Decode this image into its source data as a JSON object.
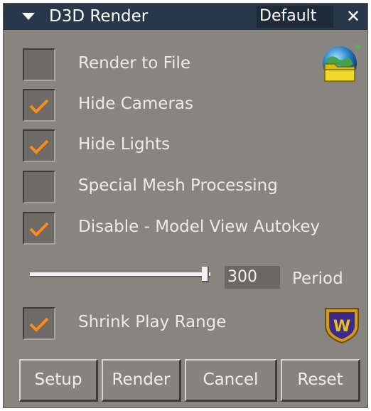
{
  "titlebar": {
    "title": "D3D Render",
    "preset": "Default",
    "close_glyph": "✕",
    "collapse_icon": "triangle-down-icon"
  },
  "options": [
    {
      "label": "Render to File",
      "checked": false
    },
    {
      "label": "Hide Cameras",
      "checked": true
    },
    {
      "label": "Hide Lights",
      "checked": true
    },
    {
      "label": "Special Mesh Processing",
      "checked": false
    },
    {
      "label": "Disable - Model View Autokey",
      "checked": true
    }
  ],
  "period": {
    "value": "300",
    "label": "Period",
    "slider_fraction": 0.97
  },
  "shrink": {
    "label": "Shrink Play Range",
    "checked": true
  },
  "icons": {
    "render_to_file": "folder-globe-icon",
    "shrink": "wolf-shield-icon"
  },
  "buttons": {
    "setup": "Setup",
    "render": "Render",
    "cancel": "Cancel",
    "reset": "Reset"
  },
  "colors": {
    "panel_bg": "#888581",
    "titlebar_bg": "#29374a",
    "checkmark": "#ff8a1c"
  }
}
